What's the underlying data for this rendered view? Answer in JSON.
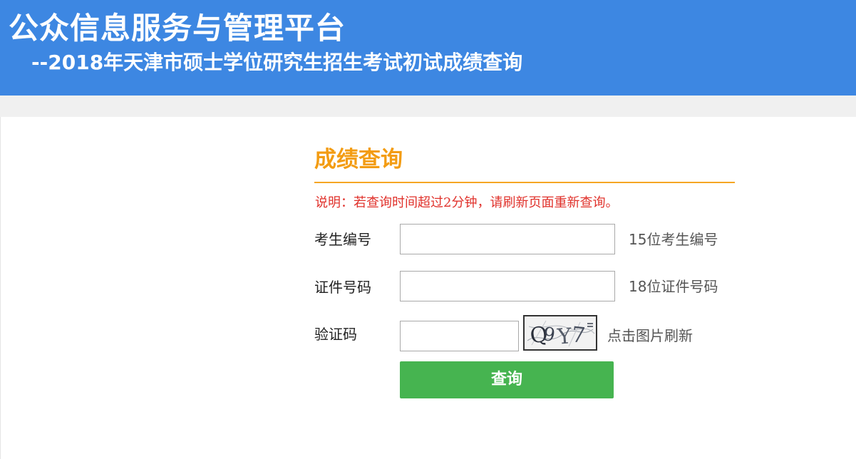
{
  "header": {
    "title": "公众信息服务与管理平台",
    "subtitle": "--2018年天津市硕士学位研究生招生考试初试成绩查询"
  },
  "form": {
    "title": "成绩查询",
    "notice": "说明：若查询时间超过2分钟，请刷新页面重新查询。",
    "fields": [
      {
        "label": "考生编号",
        "value": "",
        "hint": "15位考生编号"
      },
      {
        "label": "证件号码",
        "value": "",
        "hint": "18位证件号码"
      },
      {
        "label": "验证码",
        "value": "",
        "hint": "点击图片刷新"
      }
    ],
    "captcha_text": "Q9Y7",
    "submit_label": "查询"
  },
  "colors": {
    "header_bg": "#3d87e2",
    "title_orange": "#f39c12",
    "notice_red": "#e0312b",
    "button_green": "#46b450"
  },
  "icons": [
    "captcha-image"
  ]
}
